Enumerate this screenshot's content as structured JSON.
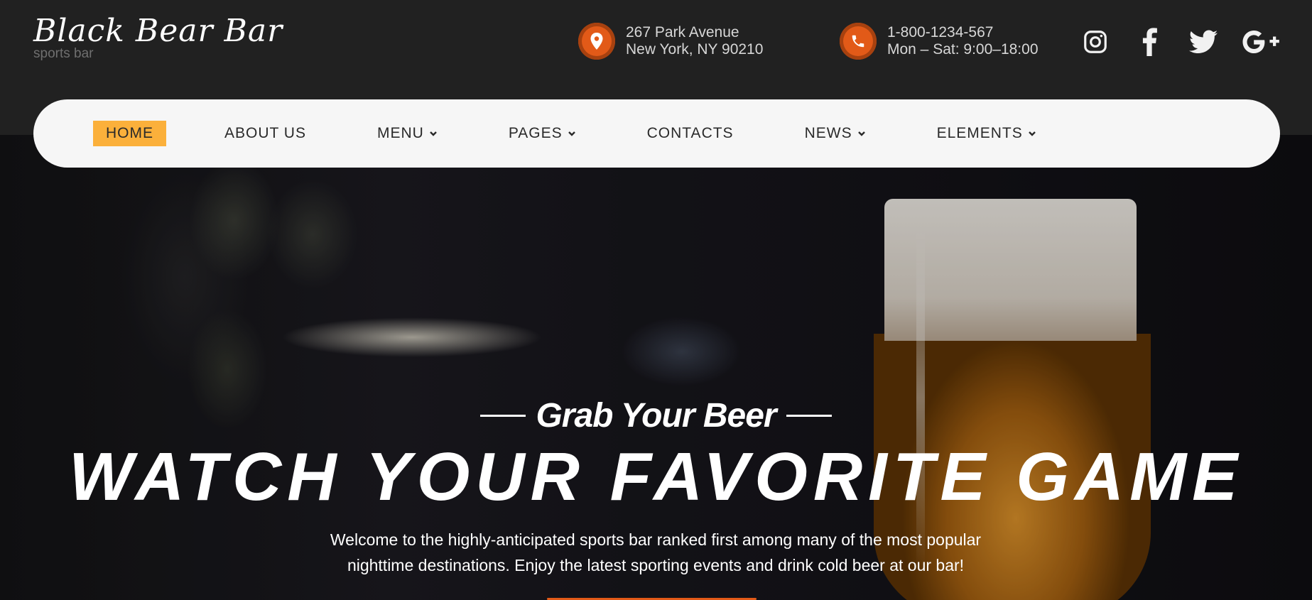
{
  "brand": {
    "name": "Black Bear Bar",
    "tagline": "sports bar"
  },
  "contacts": {
    "address": {
      "icon": "location-pin-icon",
      "line1": "267 Park Avenue",
      "line2": "New York, NY 90210"
    },
    "phone": {
      "icon": "phone-icon",
      "line1": "1-800-1234-567",
      "line2": "Mon – Sat: 9:00–18:00"
    }
  },
  "social": [
    "instagram-icon",
    "facebook-icon",
    "twitter-icon",
    "google-plus-icon"
  ],
  "nav": {
    "items": [
      {
        "label": "HOME",
        "active": true,
        "dropdown": false
      },
      {
        "label": "ABOUT US",
        "active": false,
        "dropdown": false
      },
      {
        "label": "MENU",
        "active": false,
        "dropdown": true
      },
      {
        "label": "PAGES",
        "active": false,
        "dropdown": true
      },
      {
        "label": "CONTACTS",
        "active": false,
        "dropdown": false
      },
      {
        "label": "NEWS",
        "active": false,
        "dropdown": true
      },
      {
        "label": "ELEMENTS",
        "active": false,
        "dropdown": true
      }
    ]
  },
  "hero": {
    "kicker": "Grab Your Beer",
    "headline": "WATCH YOUR FAVORITE GAME",
    "lead_line1": "Welcome to the highly-anticipated sports bar ranked first among many of the most popular",
    "lead_line2": "nighttime destinations. Enjoy the latest sporting events and drink cold beer at our bar!"
  },
  "colors": {
    "accent": "#fbb03b",
    "icon_orange": "#e25a18",
    "header_bg": "#212121"
  }
}
